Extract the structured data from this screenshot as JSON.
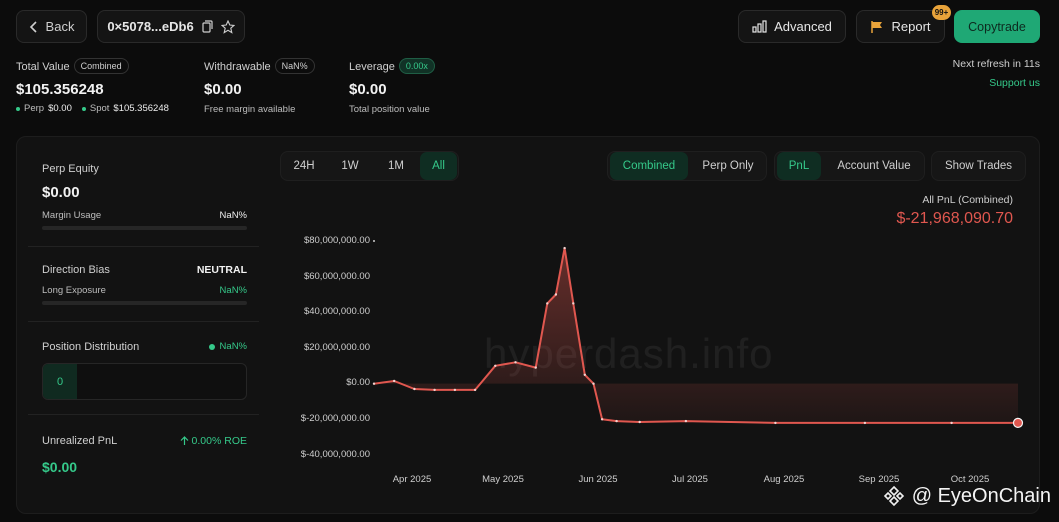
{
  "header": {
    "back_label": "Back",
    "address": "0×5078...eDb6",
    "advanced_label": "Advanced",
    "report_label": "Report",
    "report_badge": "99+",
    "copytrade_label": "Copytrade",
    "refresh_text": "Next refresh in 11s",
    "support_label": "Support us"
  },
  "stats": {
    "total_value": {
      "label": "Total Value",
      "badge": "Combined",
      "value": "$105.356248",
      "perp_label": "Perp",
      "perp_value": "$0.00",
      "spot_label": "Spot",
      "spot_value": "$105.356248"
    },
    "withdrawable": {
      "label": "Withdrawable",
      "badge": "NaN%",
      "value": "$0.00",
      "sub": "Free margin available"
    },
    "leverage": {
      "label": "Leverage",
      "badge": "0.00x",
      "value": "$0.00",
      "sub": "Total position value"
    }
  },
  "left_panel": {
    "perp_equity_label": "Perp Equity",
    "perp_equity_value": "$0.00",
    "margin_usage_label": "Margin Usage",
    "margin_usage_value": "NaN%",
    "direction_bias_label": "Direction Bias",
    "direction_bias_value": "NEUTRAL",
    "long_exposure_label": "Long Exposure",
    "long_exposure_value": "NaN%",
    "position_distribution_label": "Position Distribution",
    "position_distribution_value": "NaN%",
    "position_count": "0",
    "unrealized_pnl_label": "Unrealized PnL",
    "roe_value": "0.00% ROE",
    "unrealized_pnl_value": "$0.00"
  },
  "controls": {
    "time_ranges": [
      "24H",
      "1W",
      "1M",
      "All"
    ],
    "time_active": "All",
    "mode_options": [
      "Combined",
      "Perp Only"
    ],
    "mode_active": "Combined",
    "metric_options": [
      "PnL",
      "Account Value"
    ],
    "metric_active": "PnL",
    "show_trades_label": "Show Trades"
  },
  "chart_header": {
    "label": "All PnL (Combined)",
    "value": "$-21,968,090.70"
  },
  "watermark": "hyperdash.info",
  "brand_watermark": "@ EyeOnChain",
  "colors": {
    "accent_green": "#35c98a",
    "pnl_red": "#e0574f",
    "button_green": "#1fa875"
  },
  "chart_data": {
    "type": "area",
    "title": "All PnL (Combined)",
    "xlabel": "",
    "ylabel": "",
    "y_ticks": [
      "$80,000,000.00",
      "$60,000,000.00",
      "$40,000,000.00",
      "$20,000,000.00",
      "$0.00",
      "$-20,000,000.00",
      "$-40,000,000.00"
    ],
    "ylim": [
      -40000000,
      80000000
    ],
    "x_ticks": [
      "Apr 2025",
      "May 2025",
      "Jun 2025",
      "Jul 2025",
      "Aug 2025",
      "Sep 2025",
      "Oct 2025"
    ],
    "x": [
      "2025-03-15",
      "2025-03-22",
      "2025-03-29",
      "2025-04-05",
      "2025-04-12",
      "2025-04-19",
      "2025-04-26",
      "2025-05-03",
      "2025-05-10",
      "2025-05-14",
      "2025-05-17",
      "2025-05-20",
      "2025-05-23",
      "2025-05-27",
      "2025-05-30",
      "2025-06-02",
      "2025-06-07",
      "2025-06-15",
      "2025-07-01",
      "2025-08-01",
      "2025-09-01",
      "2025-10-01",
      "2025-10-24"
    ],
    "series": [
      {
        "values": [
          0,
          1500000,
          -3000000,
          -3500000,
          -3500000,
          -3500000,
          10000000,
          12000000,
          9000000,
          45000000,
          50000000,
          76000000,
          45000000,
          5000000,
          0,
          -20000000,
          -21000000,
          -21500000,
          -21000000,
          -22000000,
          -22000000,
          -22000000,
          -22000000
        ]
      }
    ]
  }
}
